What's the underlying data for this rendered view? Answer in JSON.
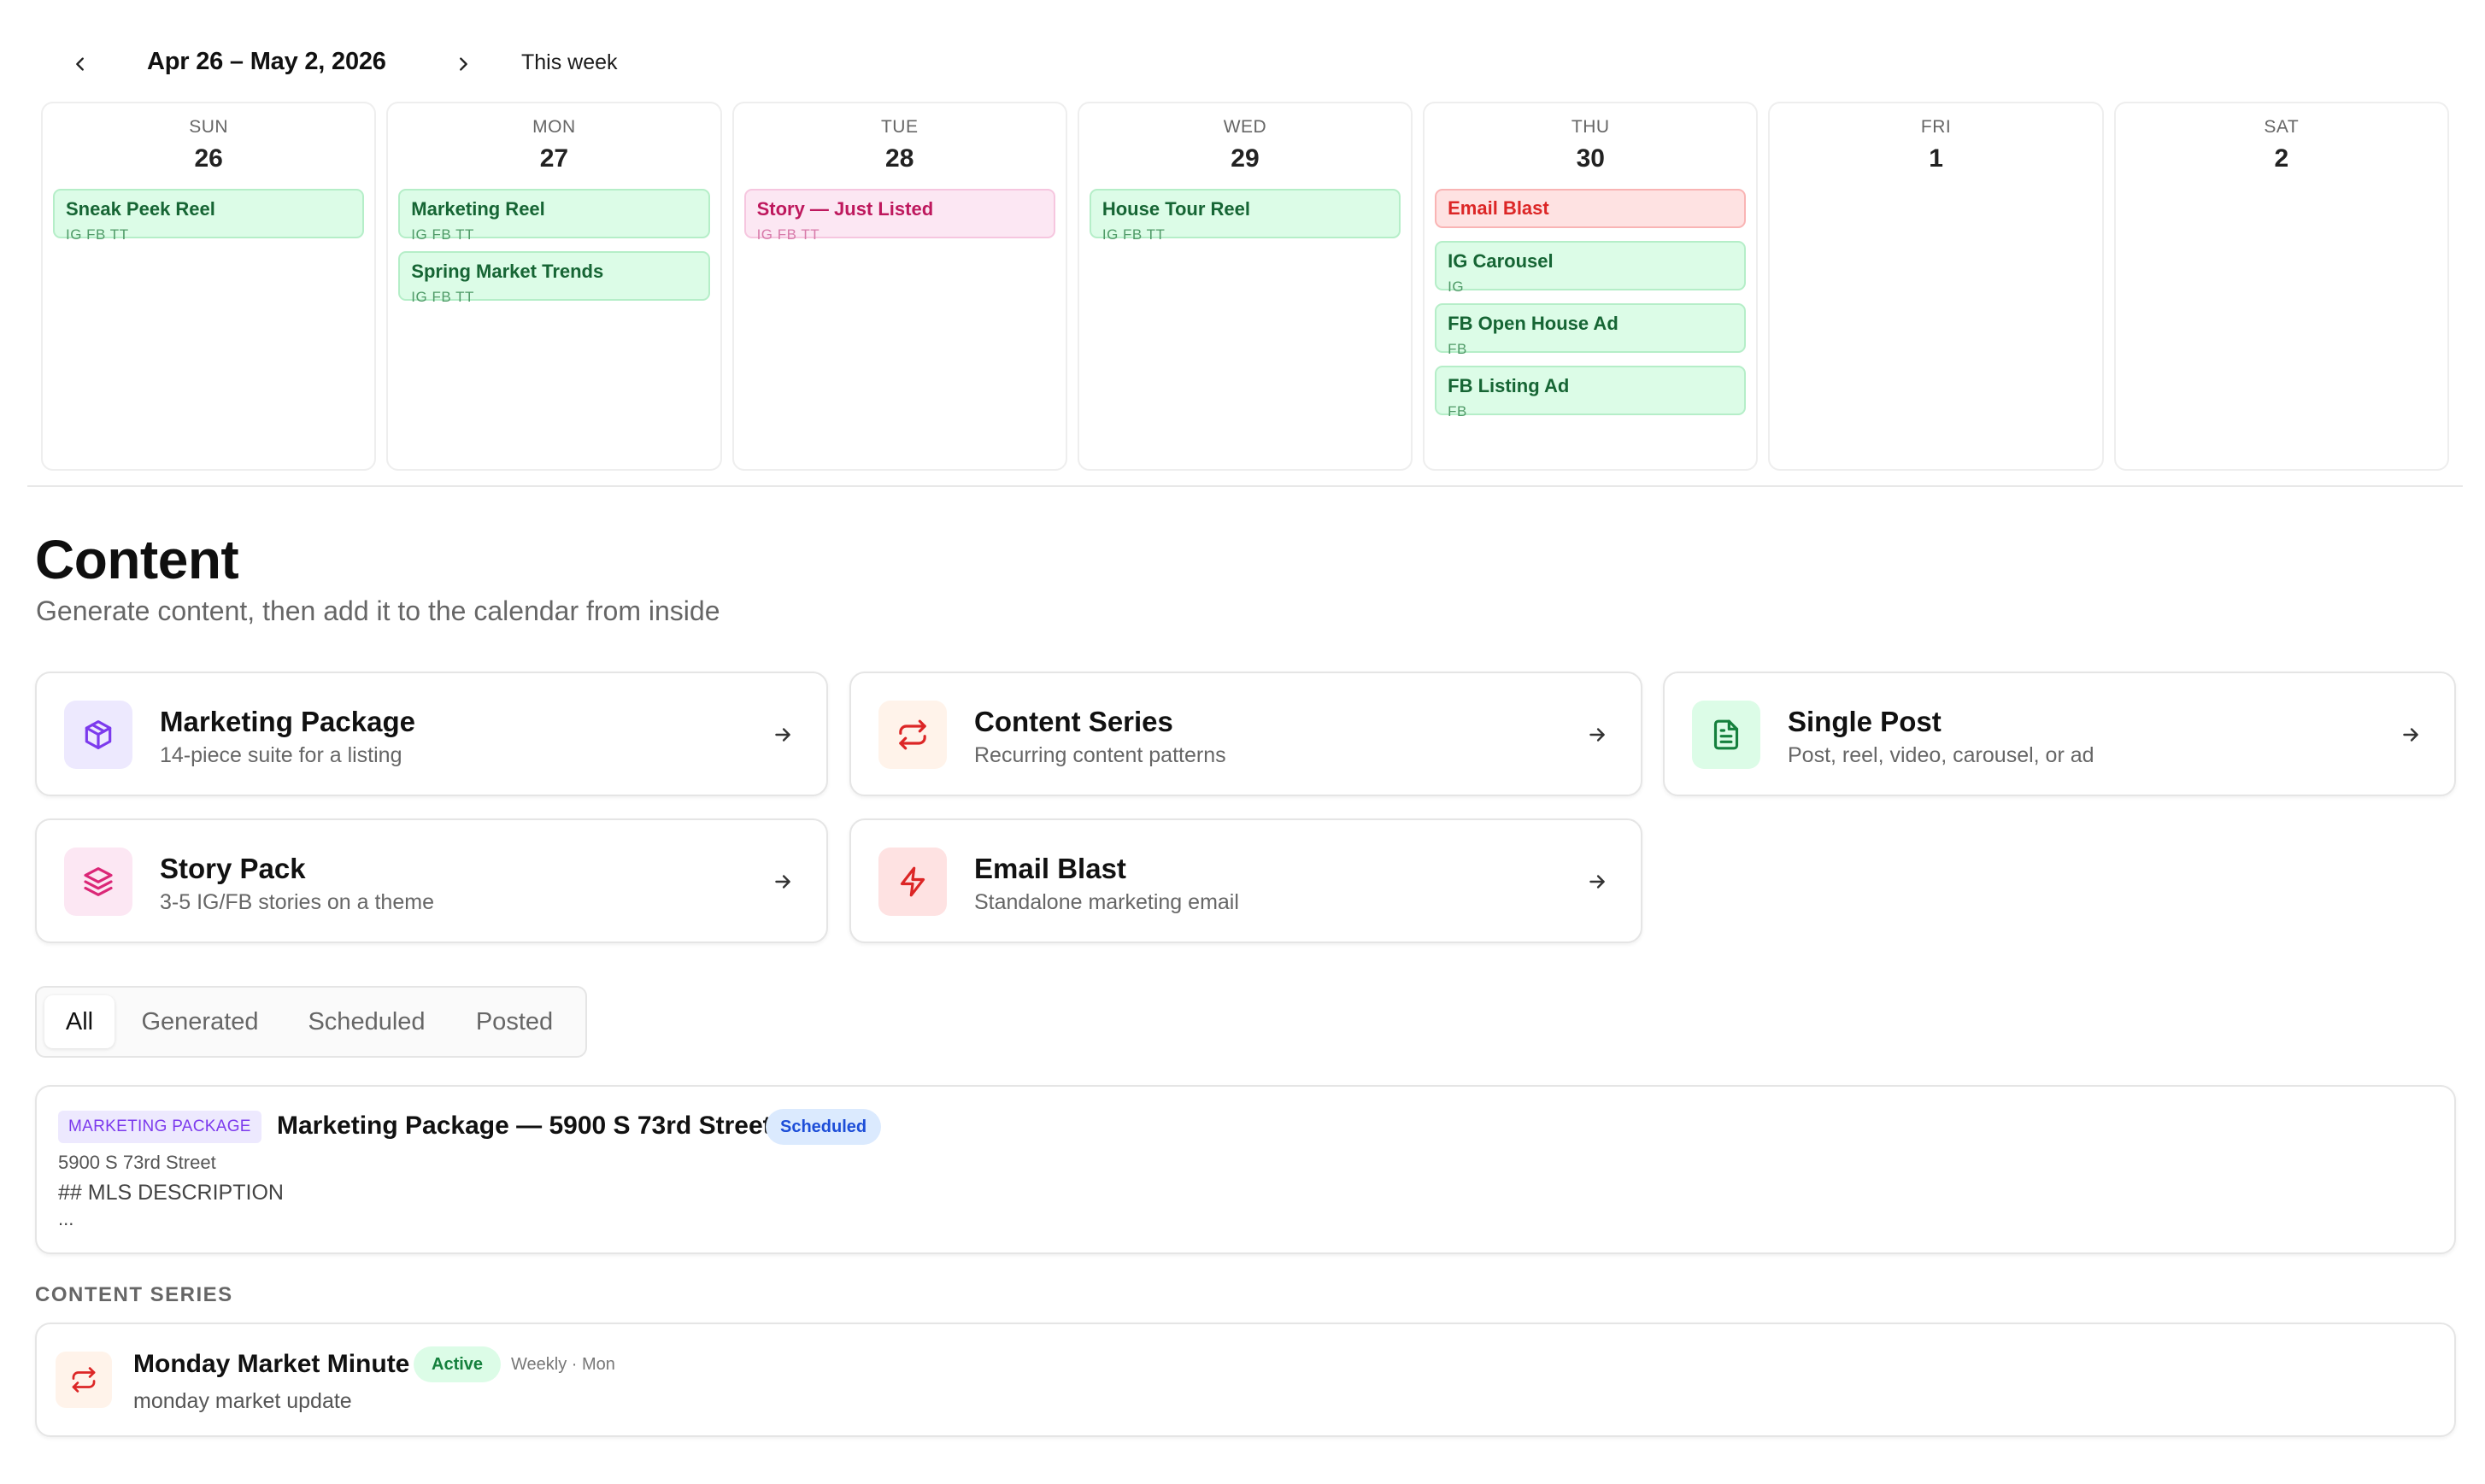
{
  "week": {
    "range": "Apr 26 – May 2, 2026",
    "this_week": "This week",
    "prev_icon": "chevron-left-icon",
    "next_icon": "chevron-right-icon"
  },
  "calendar": {
    "days": [
      {
        "dow": "SUN",
        "date": "26",
        "events": [
          {
            "title": "Sneak Peek Reel",
            "channels": "IG FB TT",
            "color": "green"
          }
        ]
      },
      {
        "dow": "MON",
        "date": "27",
        "events": [
          {
            "title": "Marketing Reel",
            "channels": "IG FB TT",
            "color": "green"
          },
          {
            "title": "Spring Market Trends",
            "channels": "IG FB TT",
            "color": "green"
          }
        ]
      },
      {
        "dow": "TUE",
        "date": "28",
        "events": [
          {
            "title": "Story — Just Listed",
            "channels": "IG FB TT",
            "color": "pink"
          }
        ]
      },
      {
        "dow": "WED",
        "date": "29",
        "events": [
          {
            "title": "House Tour Reel",
            "channels": "IG FB TT",
            "color": "green"
          }
        ]
      },
      {
        "dow": "THU",
        "date": "30",
        "events": [
          {
            "title": "Email Blast",
            "channels": "",
            "color": "red"
          },
          {
            "title": "IG Carousel",
            "channels": "IG",
            "color": "green"
          },
          {
            "title": "FB Open House Ad",
            "channels": "FB",
            "color": "green"
          },
          {
            "title": "FB Listing Ad",
            "channels": "FB",
            "color": "green"
          }
        ]
      },
      {
        "dow": "FRI",
        "date": "1",
        "events": []
      },
      {
        "dow": "SAT",
        "date": "2",
        "events": []
      }
    ]
  },
  "content": {
    "title": "Content",
    "subtitle": "Generate content, then add it to the calendar from inside"
  },
  "create_cards": [
    {
      "title": "Marketing Package",
      "desc": "14-piece suite for a listing",
      "icon": "package-icon",
      "accent": "#7c3aed",
      "bg": "#ede9fe"
    },
    {
      "title": "Content Series",
      "desc": "Recurring content patterns",
      "icon": "repeat-icon",
      "accent": "#dc2626",
      "bg": "#fff3ea"
    },
    {
      "title": "Single Post",
      "desc": "Post, reel, video, carousel, or ad",
      "icon": "document-icon",
      "accent": "#15803d",
      "bg": "#dcfce7"
    },
    {
      "title": "Story Pack",
      "desc": "3-5 IG/FB stories on a theme",
      "icon": "layers-icon",
      "accent": "#db2777",
      "bg": "#fce7f3"
    },
    {
      "title": "Email Blast",
      "desc": "Standalone marketing email",
      "icon": "zap-icon",
      "accent": "#dc2626",
      "bg": "#fee2e2"
    }
  ],
  "filters": {
    "tabs": [
      "All",
      "Generated",
      "Scheduled",
      "Posted"
    ],
    "active": "All"
  },
  "items": [
    {
      "tag": "MARKETING PACKAGE",
      "title": "Marketing Package — 5900 S 73rd Street",
      "status": "Scheduled",
      "address": "5900 S 73rd Street",
      "preview": "## MLS DESCRIPTION",
      "more": "..."
    }
  ],
  "series_section": {
    "label": "CONTENT SERIES",
    "items": [
      {
        "title": "Monday Market Minute",
        "status": "Active",
        "meta": "Weekly · Mon",
        "desc": "monday market update",
        "icon": "repeat-icon"
      }
    ]
  },
  "colors": {
    "green_event": "#dcfce7",
    "pink_event": "#fce7f3",
    "red_event": "#fee2e2",
    "scheduled_badge": "#dbeafe",
    "active_badge": "#dcfce7"
  }
}
